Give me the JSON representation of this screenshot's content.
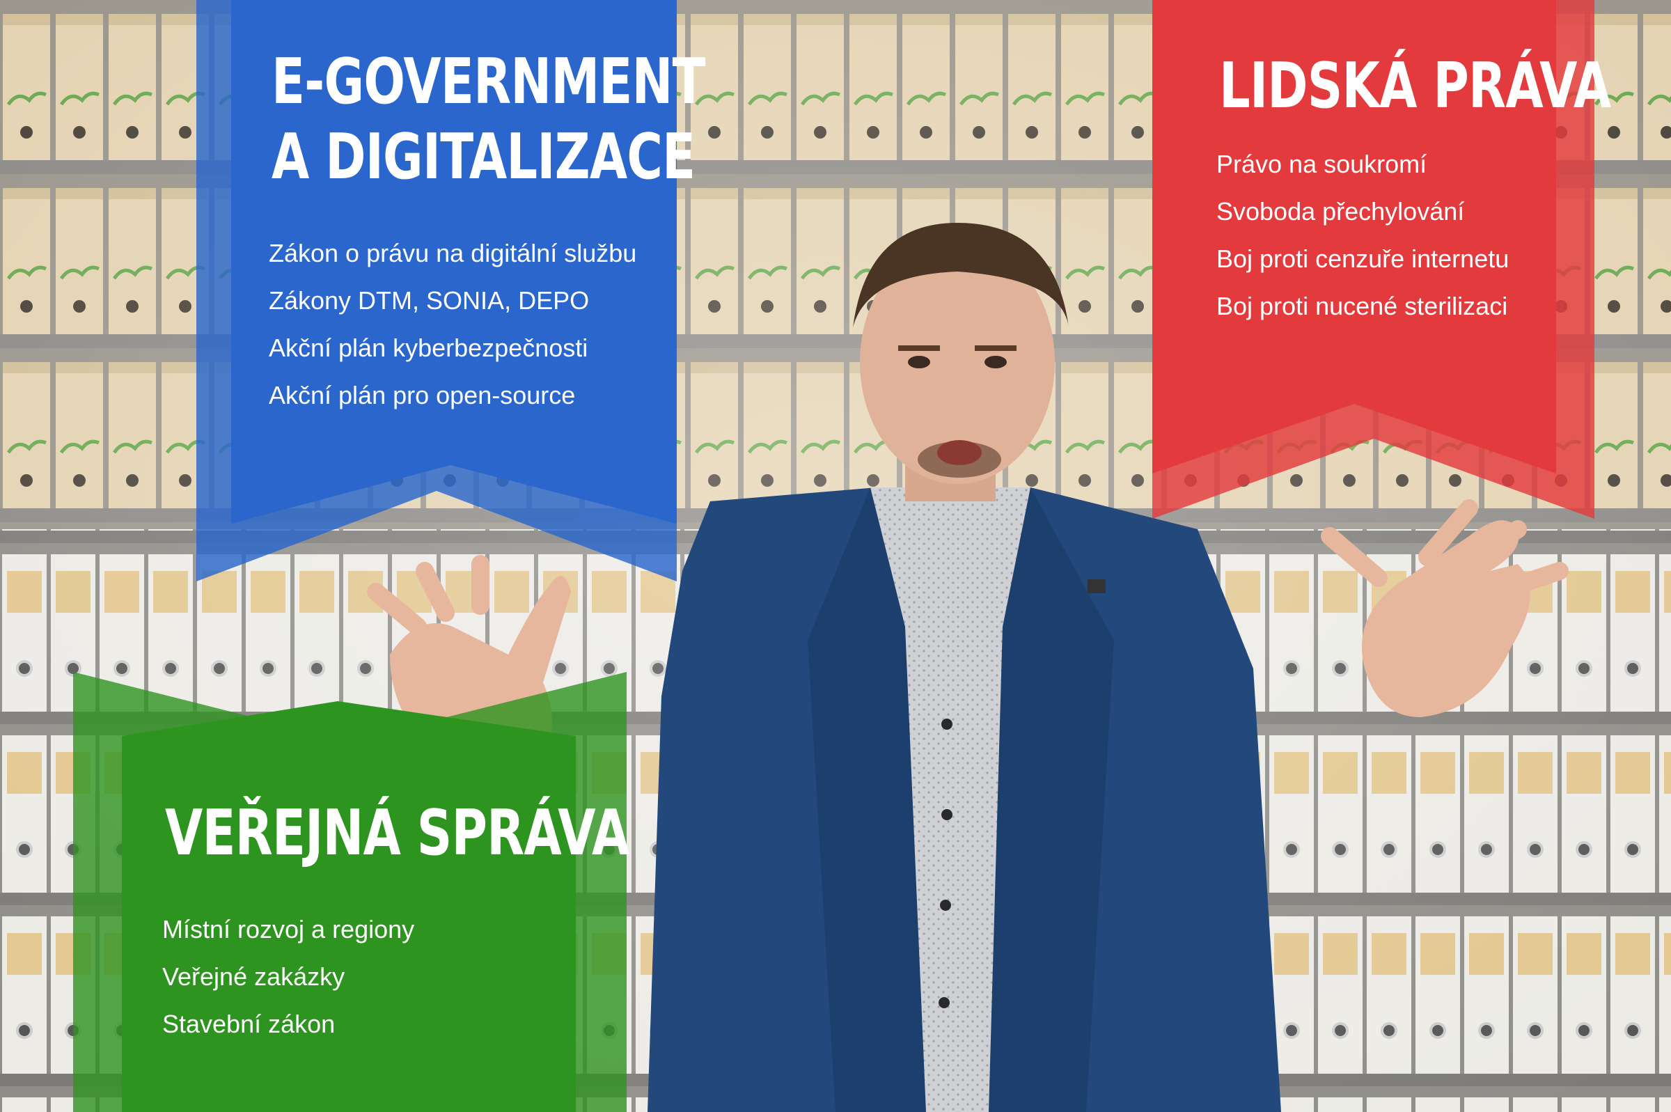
{
  "colors": {
    "blue": "#2a66cc",
    "red": "#e33a3d",
    "green": "#2e9420"
  },
  "banners": {
    "egov": {
      "title_line1": "E-GOVERNMENT",
      "title_line2": "A DIGITALIZACE",
      "items": [
        "Zákon o právu na digitální službu",
        "Zákony DTM, SONIA, DEPO",
        "Akční plán kyberbezpečnosti",
        "Akční plán pro open-source"
      ]
    },
    "rights": {
      "title": "LIDSKÁ PRÁVA",
      "items": [
        "Právo na soukromí",
        "Svoboda přechylování",
        "Boj proti cenzuře internetu",
        "Boj proti nucené sterilizaci"
      ]
    },
    "admin": {
      "title": "VEŘEJNÁ SPRÁVA",
      "items": [
        "Místní rozvoj a regiony",
        "Veřejné zakázky",
        "Stavební zákon"
      ]
    }
  }
}
